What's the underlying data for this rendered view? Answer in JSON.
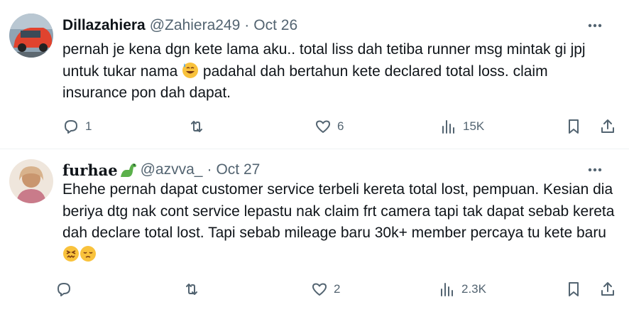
{
  "tweets": [
    {
      "name": "Dillazahiera",
      "handle": "@Zahiera249",
      "separator": "·",
      "date": "Oct 26",
      "text_parts": [
        "pernah je kena dgn kete lama aku.. total liss dah tetiba runner msg mintak gi jpj untuk tukar nama ",
        " padahal dah bertahun kete declared total loss. claim insurance pon dah dapat."
      ],
      "emojis": [
        "sweat-smile-emoji"
      ],
      "replies": "1",
      "reposts": "",
      "likes": "6",
      "views": "15K"
    },
    {
      "name": "furhae",
      "handle": "@azvva_",
      "separator": "·",
      "date": "Oct 27",
      "text_parts": [
        "Ehehe pernah dapat customer service terbeli kereta total lost, pempuan. Kesian dia beriya dtg nak cont service lepastu nak claim frt camera tapi tak dapat sebab kereta dah declare total lost. Tapi sebab mileage baru 30k+ member percaya tu kete baru"
      ],
      "emojis": [
        "confounded-emoji",
        "pensive-emoji",
        "dinosaur-emoji"
      ],
      "replies": "",
      "reposts": "",
      "likes": "2",
      "views": "2.3K"
    }
  ],
  "colors": {
    "text": "#0f1419",
    "muted": "#536471",
    "divider": "#eff3f4"
  }
}
